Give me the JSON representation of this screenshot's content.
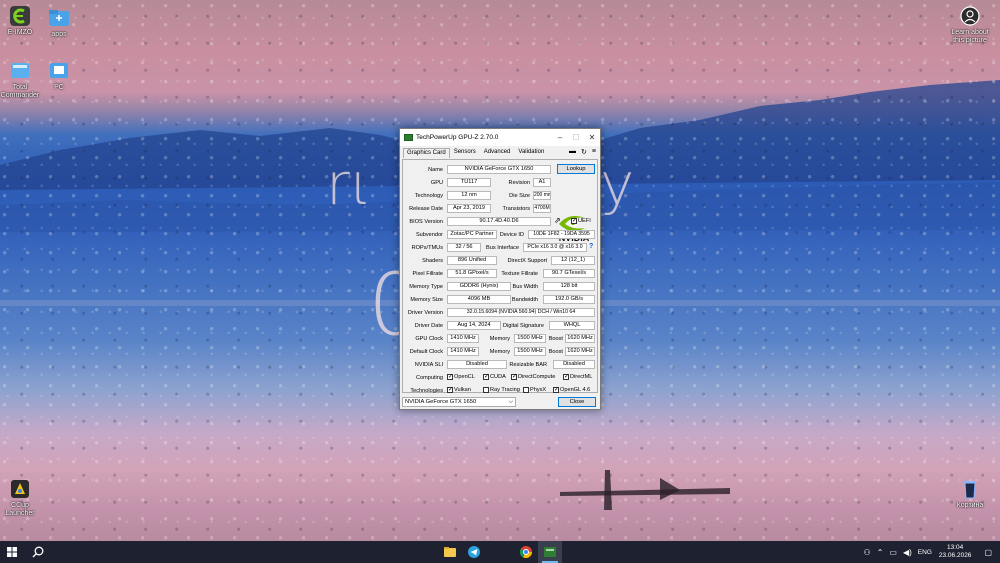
{
  "desktop": {
    "icons_left": [
      {
        "label": "E-IMZO",
        "icon": "e-imzo-icon"
      },
      {
        "label": "apps",
        "icon": "folder-icon"
      },
      {
        "label": "Total Commander",
        "icon": "total-commander-icon"
      },
      {
        "label": "PC",
        "icon": "pc-icon"
      },
      {
        "label": "CCup Launcher",
        "icon": "ccup-launcher-icon"
      }
    ],
    "icons_right": [
      {
        "label": "Learn about this picture",
        "icon": "camera-icon"
      },
      {
        "label": "Корзина",
        "icon": "recycle-bin-icon"
      }
    ]
  },
  "gpuz": {
    "title": "TechPowerUp GPU-Z 2.70.0",
    "tabs": [
      "Graphics Card",
      "Sensors",
      "Advanced",
      "Validation"
    ],
    "lookup_label": "Lookup",
    "vendor_logo_text": "NVIDIA",
    "labels": {
      "name": "Name",
      "gpu": "GPU",
      "revision": "Revision",
      "technology": "Technology",
      "die_size": "Die Size",
      "release_date": "Release Date",
      "transistors": "Transistors",
      "bios_version": "BIOS Version",
      "uefi": "UEFI",
      "subvendor": "Subvendor",
      "device_id": "Device ID",
      "rops_tmus": "ROPs/TMUs",
      "bus_interface": "Bus Interface",
      "shaders": "Shaders",
      "directx_support": "DirectX Support",
      "pixel_fillrate": "Pixel Fillrate",
      "texture_fillrate": "Texture Fillrate",
      "memory_type": "Memory Type",
      "bus_width": "Bus Width",
      "memory_size": "Memory Size",
      "bandwidth": "Bandwidth",
      "driver_version": "Driver Version",
      "driver_date": "Driver Date",
      "digital_signature": "Digital Signature",
      "gpu_clock": "GPU Clock",
      "memory": "Memory",
      "boost": "Boost",
      "default_clock": "Default Clock",
      "nvidia_sli": "NVIDIA SLI",
      "resizable_bar": "Resizable BAR",
      "computing": "Computing",
      "technologies": "Technologies"
    },
    "values": {
      "name": "NVIDIA GeForce GTX 1650",
      "gpu": "TU117",
      "revision": "A1",
      "technology": "12 nm",
      "die_size": "200 mm²",
      "release_date": "Apr 23, 2019",
      "transistors": "4700M",
      "bios_version": "90.17.4D.40.D6",
      "subvendor": "Zotac/PC Partner",
      "device_id": "10DE 1F82 - 19DA 3595",
      "rops_tmus": "32 / 56",
      "bus_interface": "PCIe x16 3.0 @ x16 3.0",
      "shaders": "896 Unified",
      "directx_support": "12 (12_1)",
      "pixel_fillrate": "51.8 GPixel/s",
      "texture_fillrate": "90.7 GTexel/s",
      "memory_type": "GDDR6 (Hynix)",
      "bus_width": "128 bit",
      "memory_size": "4096 MB",
      "bandwidth": "192.0 GB/s",
      "driver_version": "32.0.15.6094 (NVIDIA 560.94) DCH / Win10 64",
      "driver_date": "Aug 14, 2024",
      "digital_signature": "WHQL",
      "gpu_clock": "1410 MHz",
      "gpu_memory": "1500 MHz",
      "gpu_boost": "1620 MHz",
      "default_clock": "1410 MHz",
      "default_memory": "1500 MHz",
      "default_boost": "1620 MHz",
      "nvidia_sli": "Disabled",
      "resizable_bar": "Disabled"
    },
    "computing": [
      {
        "label": "OpenCL",
        "checked": true
      },
      {
        "label": "CUDA",
        "checked": true
      },
      {
        "label": "DirectCompute",
        "checked": true
      },
      {
        "label": "DirectML",
        "checked": true
      }
    ],
    "technologies": [
      {
        "label": "Vulkan",
        "checked": true
      },
      {
        "label": "Ray Tracing",
        "checked": false
      },
      {
        "label": "PhysX",
        "checked": false
      },
      {
        "label": "OpenGL 4.6",
        "checked": true
      }
    ],
    "selected_gpu": "NVIDIA GeForce GTX 1650",
    "close_label": "Close"
  },
  "taskbar": {
    "apps": [
      "file-explorer-icon",
      "telegram-icon",
      "chrome-icon",
      "gpuz-icon"
    ],
    "language": "ENG",
    "time": "13:04",
    "date": "23.06.2026"
  },
  "colors": {
    "nvidia_green": "#76b900",
    "accent": "#0078d7",
    "taskbar": "#1e2230"
  }
}
